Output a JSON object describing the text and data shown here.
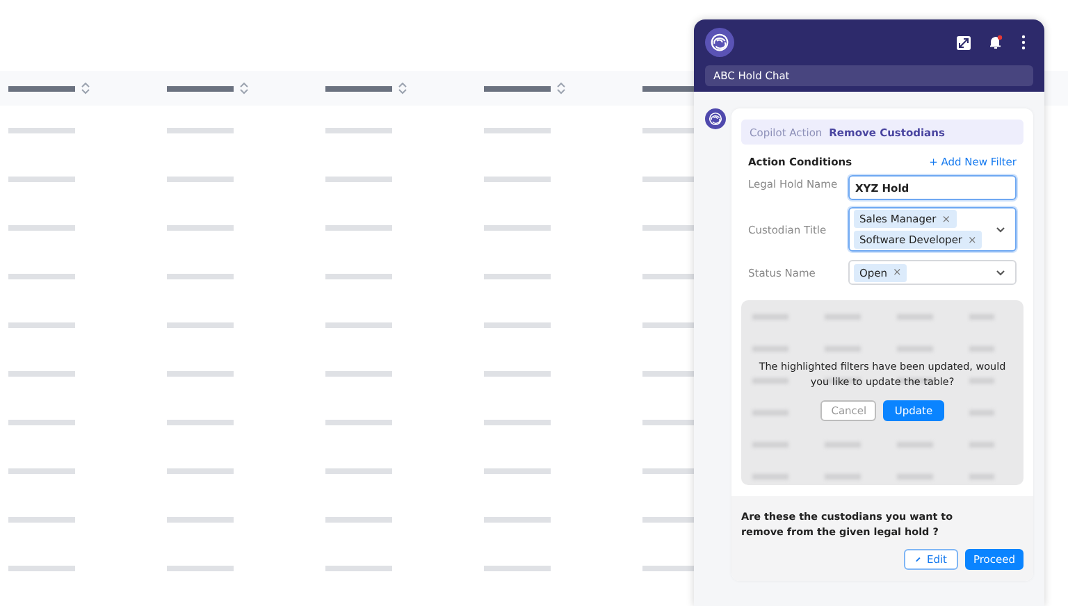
{
  "chat_panel": {
    "chat_title": "ABC Hold Chat"
  },
  "copilot_action": {
    "label": "Copilot Action",
    "action": "Remove Custodians"
  },
  "action_conditions": {
    "title": "Action Conditions",
    "add_filter": "+ Add New Filter",
    "fields": [
      {
        "kind": "text",
        "label": "Legal Hold Name",
        "value": "XYZ Hold",
        "focused": true
      },
      {
        "kind": "multiselect",
        "label": "Custodian Title",
        "chips": [
          "Sales Manager",
          "Software Developer"
        ],
        "chip_remove": "×",
        "focused": true
      },
      {
        "kind": "multiselect",
        "label": "Status Name",
        "chips": [
          "Open"
        ],
        "chip_remove": "×",
        "focused": false
      }
    ]
  },
  "update_dialog": {
    "message": "The highlighted filters have been updated, would you like to update the table?",
    "buttons": [
      {
        "kind": "secondary",
        "label": "Cancel"
      },
      {
        "kind": "primary",
        "label": "Update"
      }
    ]
  },
  "confirmation": {
    "question": "Are these the custodians you want to remove from the given legal hold ?",
    "buttons": [
      {
        "kind": "edit",
        "label": "Edit"
      },
      {
        "kind": "primary",
        "label": "Proceed"
      }
    ]
  }
}
